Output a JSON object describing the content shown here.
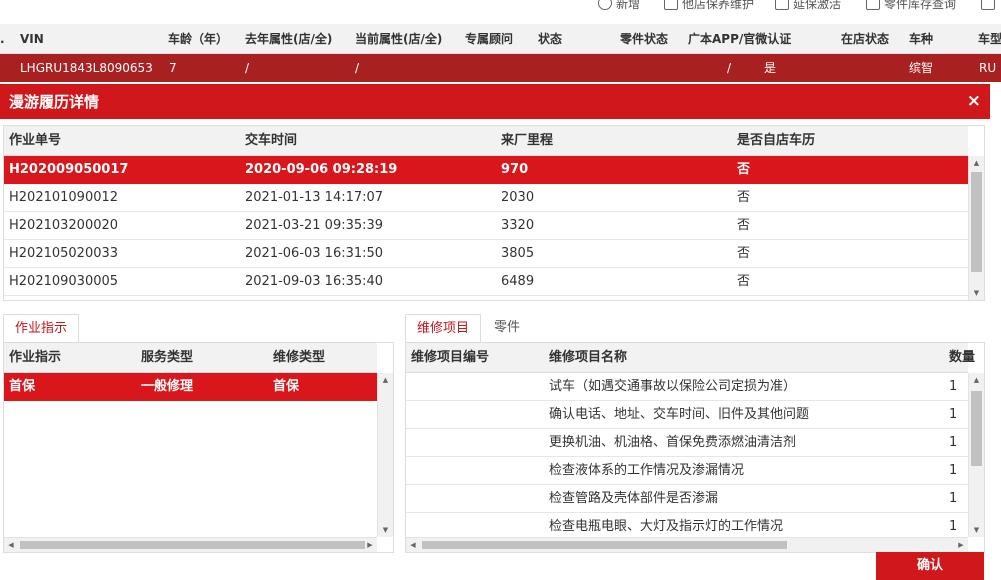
{
  "toolbar": {
    "items": [
      {
        "label": "新增",
        "icon": "plus-circle-icon"
      },
      {
        "label": "他店保养维护",
        "icon": "document-icon"
      },
      {
        "label": "延保激活",
        "icon": "edit-icon"
      },
      {
        "label": "零件库存查询",
        "icon": "inventory-icon"
      },
      {
        "label": "",
        "icon": "plus-box-icon"
      }
    ]
  },
  "background_table": {
    "headers": [
      ".",
      "VIN",
      "车龄（年）",
      "去年属性(店/全)",
      "当前属性(店/全)",
      "专属顾问",
      "状态",
      "零件状态",
      "广本APP/官微认证",
      "在店状态",
      "车种",
      "车型"
    ],
    "row": {
      "vin": "LHGRU1843L8090653",
      "age": "7",
      "last_attr": "/",
      "cur_attr": "/",
      "app_slash": "/",
      "app": "是",
      "car_type": "缤智",
      "model": "RU"
    }
  },
  "modal": {
    "title": "漫游履历详情",
    "close": "×",
    "history": {
      "headers": [
        "作业单号",
        "交车时间",
        "来厂里程",
        "是否自店车历"
      ],
      "rows": [
        {
          "no": "H202009050017",
          "time": "2020-09-06 09:28:19",
          "mileage": "970",
          "own": "否"
        },
        {
          "no": "H202101090012",
          "time": "2021-01-13 14:17:07",
          "mileage": "2030",
          "own": "否"
        },
        {
          "no": "H202103200020",
          "time": "2021-03-21 09:35:39",
          "mileage": "3320",
          "own": "否"
        },
        {
          "no": "H202105020033",
          "time": "2021-06-03 16:31:50",
          "mileage": "3805",
          "own": "否"
        },
        {
          "no": "H202109030005",
          "time": "2021-09-03 16:35:40",
          "mileage": "6489",
          "own": "否"
        }
      ]
    },
    "left_tab": "作业指示",
    "instructions": {
      "headers": [
        "作业指示",
        "服务类型",
        "维修类型"
      ],
      "rows": [
        {
          "ins": "首保",
          "svc": "一般修理",
          "rep": "首保"
        }
      ]
    },
    "right_tabs": [
      "维修项目",
      "零件"
    ],
    "repairs": {
      "headers": [
        "维修项目编号",
        "维修项目名称",
        "数量"
      ],
      "rows": [
        {
          "code": "",
          "name": "试车（如遇交通事故以保险公司定损为准）",
          "qty": "1"
        },
        {
          "code": "",
          "name": "确认电话、地址、交车时间、旧件及其他问题",
          "qty": "1"
        },
        {
          "code": "",
          "name": "更换机油、机油格、首保免费添燃油清洁剂",
          "qty": "1"
        },
        {
          "code": "",
          "name": "检查液体系的工作情况及渗漏情况",
          "qty": "1"
        },
        {
          "code": "",
          "name": "检查管路及壳体部件是否渗漏",
          "qty": "1"
        },
        {
          "code": "",
          "name": "检查电瓶电眼、大灯及指示灯的工作情况",
          "qty": "1"
        }
      ]
    },
    "confirm": "确认"
  }
}
